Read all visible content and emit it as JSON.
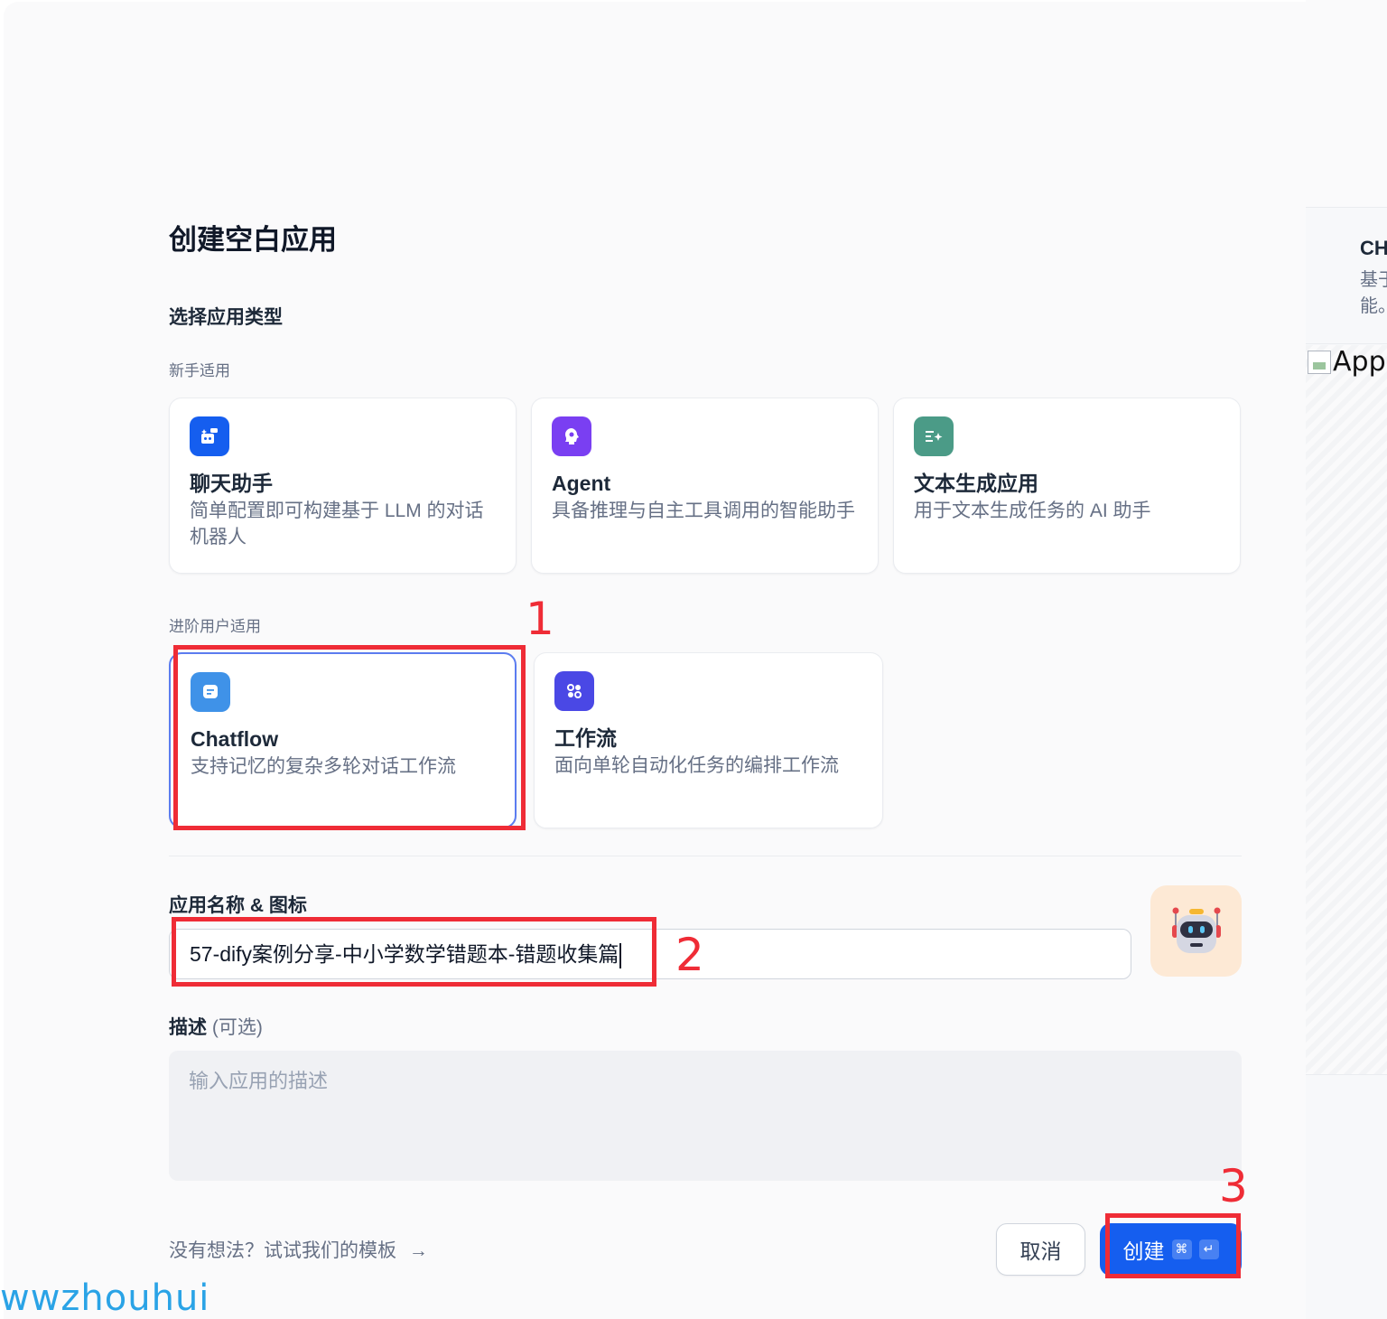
{
  "dialog": {
    "title": "创建空白应用",
    "section_type_title": "选择应用类型",
    "beginner_label": "新手适用",
    "advanced_label": "进阶用户适用",
    "app_types": [
      {
        "title": "聊天助手",
        "desc": "简单配置即可构建基于 LLM 的对话机器人",
        "icon": "chat-bot-icon",
        "color": "#155eef"
      },
      {
        "title": "Agent",
        "desc": "具备推理与自主工具调用的智能助手",
        "icon": "agent-icon",
        "color": "#7a3ff2"
      },
      {
        "title": "文本生成应用",
        "desc": "用于文本生成任务的 AI 助手",
        "icon": "text-generation-icon",
        "color": "#4b9b87"
      },
      {
        "title": "Chatflow",
        "desc": "支持记忆的复杂多轮对话工作流",
        "icon": "chatflow-icon",
        "color": "#3f92e8",
        "selected": true
      },
      {
        "title": "工作流",
        "desc": "面向单轮自动化任务的编排工作流",
        "icon": "workflow-icon",
        "color": "#4a48e5"
      }
    ],
    "name_icon_label": "应用名称 & 图标",
    "name_value": "57-dify案例分享-中小学数学错题本-错题收集篇",
    "avatar_icon": "robot-icon",
    "description_label": "描述",
    "description_optional": "(可选)",
    "description_placeholder": "输入应用的描述",
    "template_link": "没有想法？试试我们的模板",
    "cancel_label": "取消",
    "create_label": "创建",
    "shortcut_cmd": "⌘",
    "shortcut_enter": "↵"
  },
  "side_panel": {
    "title": "CH",
    "desc_line1": "基于",
    "desc_line2": "能。",
    "image_alt": "App"
  },
  "annotations": [
    "1",
    "2",
    "3"
  ],
  "watermark": "wwzhouhui",
  "colors": {
    "primary": "#155eef",
    "annotation": "#ef2c36",
    "watermark": "#2aa3e6"
  }
}
